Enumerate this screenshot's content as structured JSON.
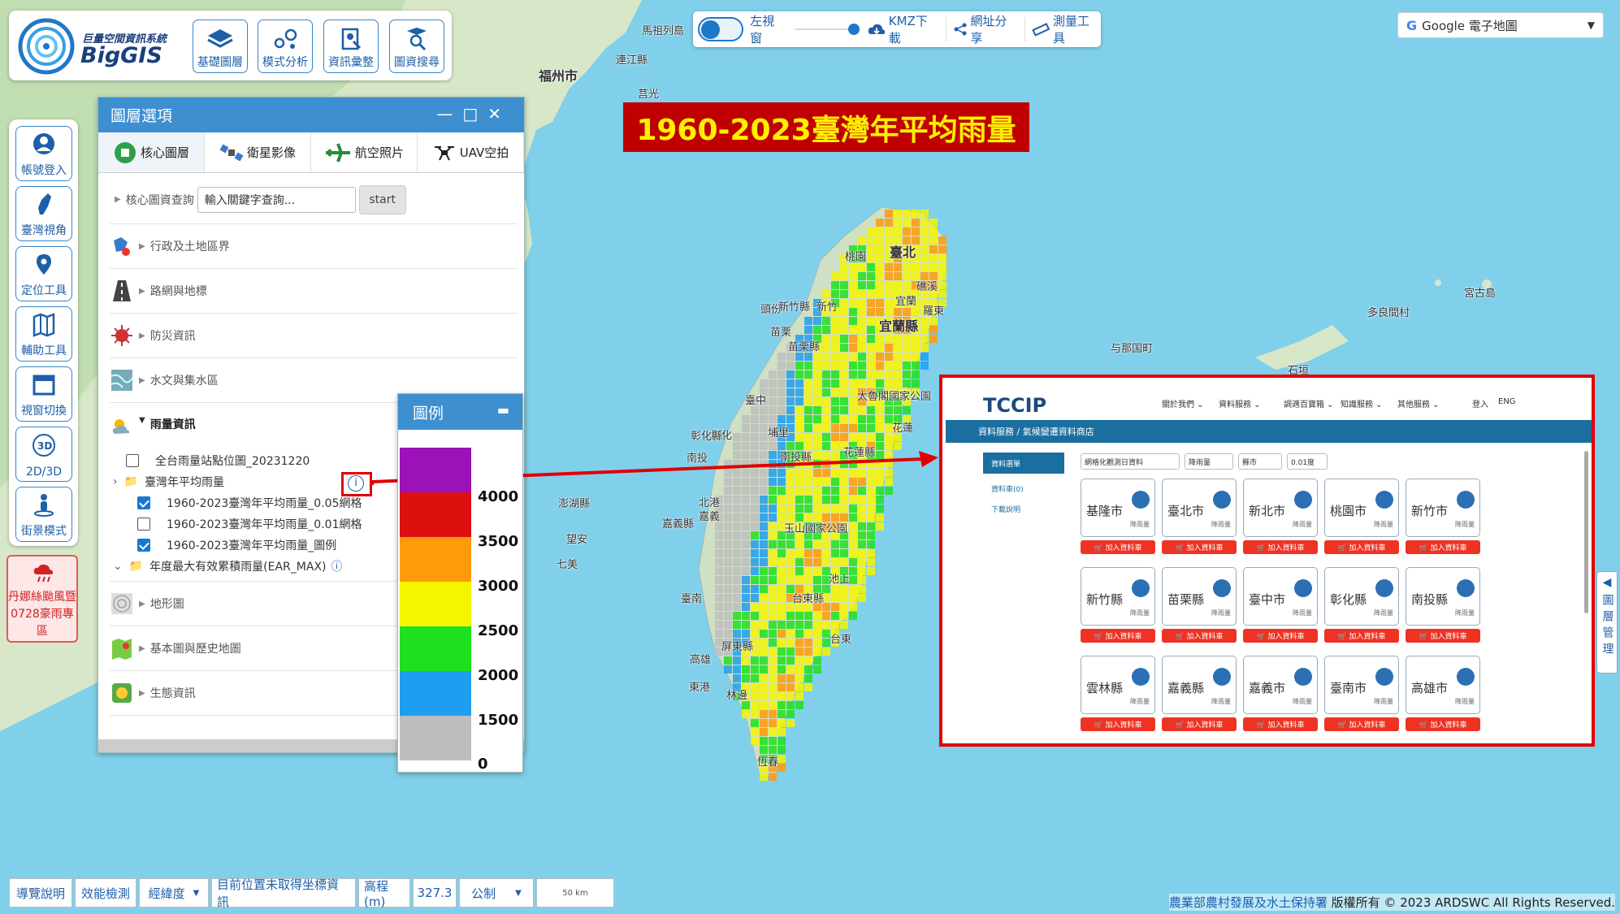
{
  "logo": {
    "subtitle": "巨量空間資訊系統",
    "name": "BigGIS"
  },
  "top_buttons": [
    "基礎圖層",
    "模式分析",
    "資訊彙整",
    "圖資搜尋"
  ],
  "toolbar": {
    "split_window": "左視窗",
    "kmz": "KMZ下載",
    "share": "網址分享",
    "measure": "測量工具"
  },
  "basemap_select": "Google 電子地圖",
  "sidebar": [
    "帳號登入",
    "臺灣視角",
    "定位工具",
    "輔助工具",
    "視窗切換",
    "2D/3D",
    "街景模式"
  ],
  "sidebar_3d_text": "3D",
  "typhoon_button": "丹娜絲颱風暨0728豪雨專區",
  "panel": {
    "title": "圖層選項",
    "tabs": [
      "核心圖層",
      "衛星影像",
      "航空照片",
      "UAV空拍"
    ],
    "search_label": "核心圖資查詢",
    "search_placeholder": "輸入關鍵字查詢...",
    "search_button": "start",
    "categories": [
      "行政及土地區界",
      "路網與地標",
      "防災資訊",
      "水文與集水區",
      "雨量資訊",
      "地形圖",
      "基本圖與歷史地圖",
      "生態資訊"
    ],
    "rain_items": {
      "stations": "全台雨量站點位圖_20231220",
      "annual_folder": "臺灣年平均雨量",
      "grid005": "1960-2023臺灣年平均雨量_0.05網格",
      "grid001": "1960-2023臺灣年平均雨量_0.01網格",
      "legend_layer": "1960-2023臺灣年平均雨量_圖例",
      "earmax": "年度最大有效累積雨量(EAR_MAX)"
    }
  },
  "legend": {
    "title": "圖例",
    "levels": [
      "4000",
      "3500",
      "3000",
      "2500",
      "2000",
      "1500",
      "0"
    ],
    "colors": [
      "#9b12b8",
      "#dd1010",
      "#ff9a0a",
      "#f5f500",
      "#1ee01e",
      "#1e9ef0",
      "#bdbdbd"
    ]
  },
  "banner": "1960-2023臺灣年平均雨量",
  "inset": {
    "logo": "TCCIP",
    "nav": [
      "關於我們",
      "資料服務",
      "調適百寶箱",
      "知識服務",
      "其他服務",
      "登入",
      "ENG"
    ],
    "breadcrumb": "資料服務 / 氣候變遷資料商店",
    "side": [
      "資料選單",
      "資料車(0)",
      "下載說明"
    ],
    "filters": [
      "網格化觀測日資料",
      "降雨量",
      "縣市",
      "0.01度"
    ],
    "cities": [
      "基隆市",
      "臺北市",
      "新北市",
      "桃園市",
      "新竹市",
      "新竹縣",
      "苗栗縣",
      "臺中市",
      "彰化縣",
      "南投縣",
      "雲林縣",
      "嘉義縣",
      "嘉義市",
      "臺南市",
      "高雄市"
    ],
    "card_sub": "降雨量",
    "add_label": "加入資料車"
  },
  "right_tab": "圖層管理",
  "bottom": {
    "guide": "導覽說明",
    "perf": "效能檢測",
    "coord_sys": "經緯度",
    "pos_info": "目前位置未取得坐標資訊",
    "elev_label": "高程(m)",
    "elev_value": "327.3",
    "unit": "公制",
    "scale": "50 km"
  },
  "copyright": {
    "org": "農業部農村發展及水土保持署",
    "rest": "版權所有 © 2023 ARDSWC All Rights Reserved."
  },
  "map_labels": [
    "臺北",
    "桃園",
    "新竹",
    "宜蘭",
    "礁溪",
    "羅東",
    "苗栗",
    "苗栗縣",
    "頭份",
    "宜蘭縣",
    "新竹縣",
    "臺中",
    "太魯閣國家公園",
    "花蓮",
    "彰化",
    "彰化縣",
    "南投",
    "南投縣",
    "埔里",
    "花蓮縣",
    "澎湖縣",
    "望安",
    "七美",
    "嘉義",
    "嘉義縣",
    "玉山國家公園",
    "臺南",
    "台東縣",
    "池上",
    "高雄",
    "屏東縣",
    "台東",
    "林邊",
    "東港",
    "恆春",
    "福州市",
    "連江縣",
    "莒光",
    "馬祖列島",
    "宮古島",
    "多良間村",
    "与那国町",
    "石垣",
    "北港"
  ]
}
